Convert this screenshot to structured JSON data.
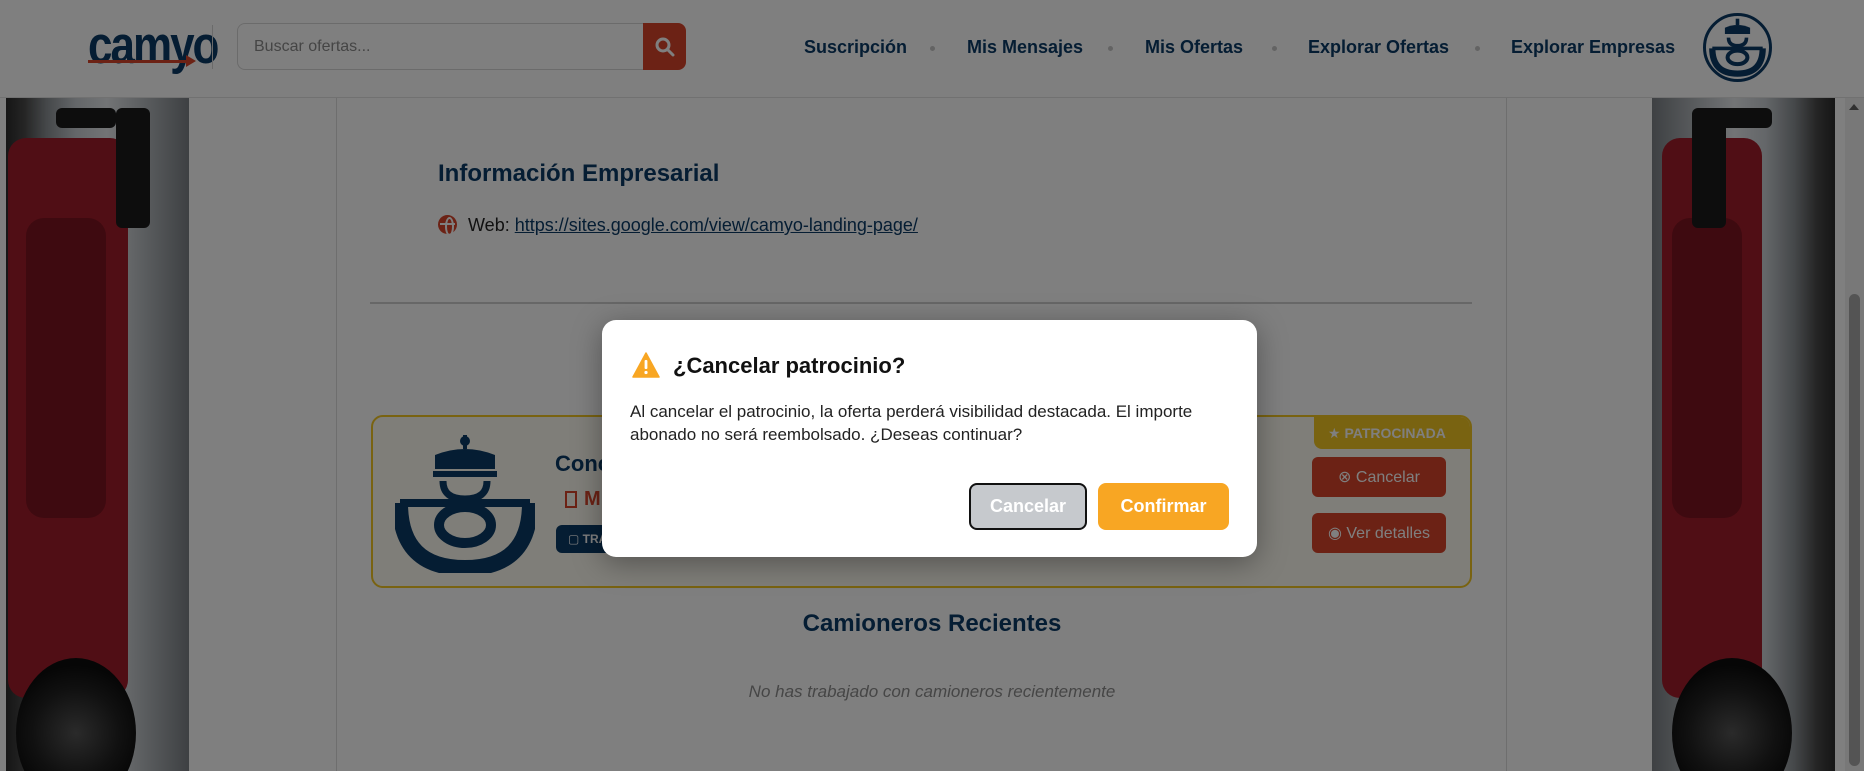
{
  "header": {
    "logo_text": "camyo",
    "search_placeholder": "Buscar ofertas...",
    "nav": [
      "Suscripción",
      "Mis Mensajes",
      "Mis Ofertas",
      "Explorar Ofertas",
      "Explorar Empresas"
    ]
  },
  "company_info": {
    "title": "Información Empresarial",
    "web_label": "Web:",
    "web_url": "https://sites.google.com/view/camyo-landing-page/"
  },
  "offer_card": {
    "title": "Conc",
    "company": "M",
    "tag": "TRA",
    "badge": "PATROCINADA",
    "cancel_label": "Cancelar",
    "details_label": "Ver detalles"
  },
  "recent": {
    "title": "Camioneros Recientes",
    "empty_text": "No has trabajado con camioneros recientemente"
  },
  "modal": {
    "title": "¿Cancelar patrocinio?",
    "body": "Al cancelar el patrocinio, la oferta perderá visibilidad destacada. El importe abonado no será reembolsado. ¿Deseas continuar?",
    "cancel_label": "Cancelar",
    "confirm_label": "Confirmar"
  },
  "icons": {
    "search": "search-icon",
    "warning": "warning-icon",
    "globe": "globe-icon",
    "star": "star-icon",
    "eye": "eye-icon",
    "circle_x": "circle-x-icon",
    "building": "building-icon",
    "briefcase": "briefcase-icon"
  },
  "colors": {
    "brand_navy": "#0b3a66",
    "brand_red": "#d8452a",
    "confirm_orange": "#f8a623",
    "sponsored_yellow": "#f3c623"
  }
}
